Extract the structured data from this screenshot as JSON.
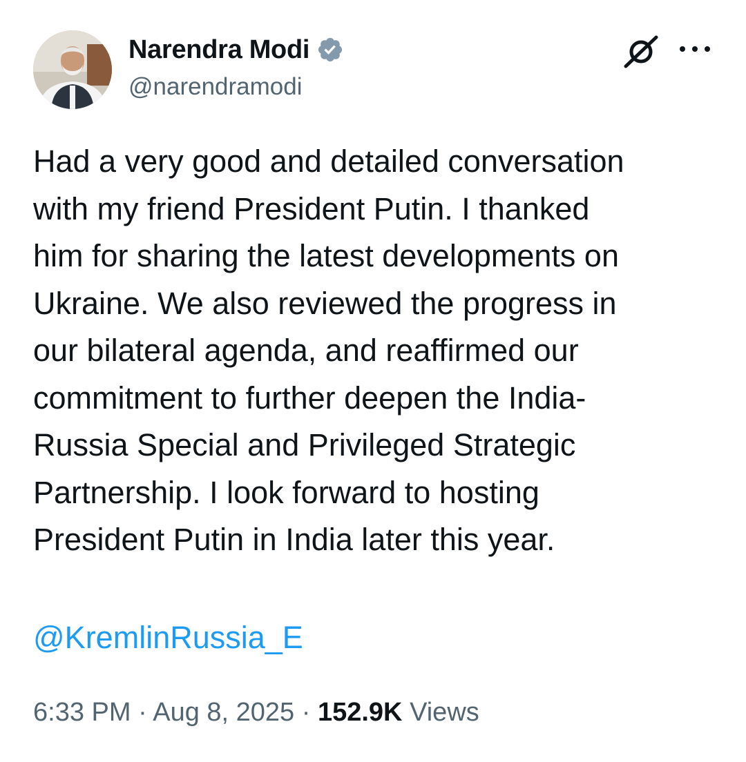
{
  "author": {
    "display_name": "Narendra Modi",
    "handle": "@narendramodi",
    "verified": true
  },
  "header_icons": [
    "grok-icon",
    "more-options-icon"
  ],
  "tweet": {
    "text": "Had a very good and detailed conversation\nwith my friend President Putin. I thanked\nhim for sharing the latest developments on\nUkraine. We also reviewed the progress in\nour bilateral agenda, and reaffirmed our\ncommitment to further deepen the India-\nRussia Special and Privileged Strategic\nPartnership. I look forward to hosting\nPresident Putin in India later this year.",
    "mention": "@KremlinRussia_E"
  },
  "meta": {
    "time": "6:33 PM",
    "separator": "·",
    "date": "Aug 8, 2025",
    "views_count": "152.9K",
    "views_label": "Views"
  },
  "colors": {
    "text": "#0f1419",
    "secondary": "#536471",
    "link": "#1d9bf0",
    "verified_badge": "#829aab"
  }
}
